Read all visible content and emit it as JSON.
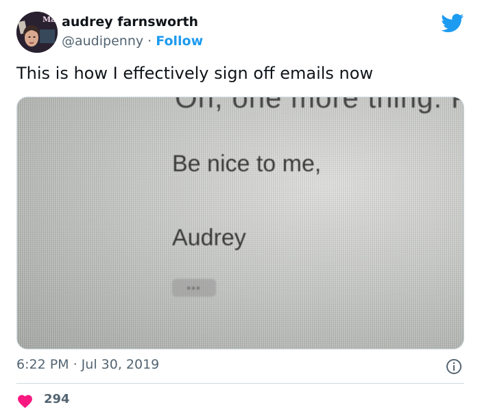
{
  "author": {
    "name": "audrey farnsworth",
    "handle": "@audipenny",
    "separator": "·",
    "follow_label": "Follow",
    "avatar_text": "Mae"
  },
  "tweet": {
    "text": "This is how I effectively sign off emails now",
    "timestamp": "6:22 PM · Jul 30, 2019"
  },
  "media": {
    "cut_off_text": "Oh, one more thing. Proba",
    "line_1": "Be nice to me,",
    "line_2": "Audrey",
    "dots": "•••"
  },
  "engagement": {
    "likes": "294"
  },
  "colors": {
    "accent": "#1d9bf0",
    "like": "#f91880",
    "secondary_text": "#536471"
  },
  "icons": {
    "brand": "twitter-bird-icon",
    "info": "info-icon",
    "like": "heart-icon"
  }
}
